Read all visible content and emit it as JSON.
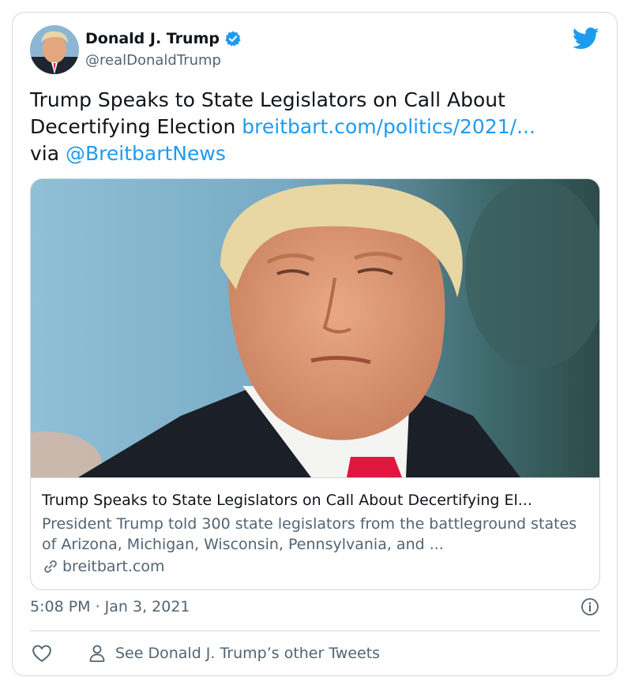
{
  "author": {
    "name": "Donald J. Trump",
    "handle": "@realDonaldTrump",
    "verified_icon": "verified-badge-icon",
    "avatar_icon": "avatar"
  },
  "platform_icon": "twitter-bird-icon",
  "tweet": {
    "text": "Trump Speaks to State Legislators on Call About Decertifying Election",
    "link": "breitbart.com/politics/2021/...",
    "via_prefix": "via",
    "via_handle": "@BreitbartNews"
  },
  "link_card": {
    "title": "Trump Speaks to State Legislators on Call About Decertifying El...",
    "description": "President Trump told 300 state legislators from the battleground states of Arizona, Michigan, Wisconsin, Pennsylvania, and ...",
    "domain": "breitbart.com",
    "domain_icon": "link-icon"
  },
  "timestamp": "5:08 PM · Jan 3, 2021",
  "actions": {
    "like_icon": "heart-icon",
    "info_icon": "info-icon",
    "other_tweets_label": "See Donald J. Trump’s other Tweets",
    "other_tweets_icon": "person-icon"
  },
  "colors": {
    "accent": "#1d9bf0",
    "text": "#0f1419",
    "secondary": "#536471",
    "border": "#cfd9de",
    "tie": "#e0163f"
  }
}
